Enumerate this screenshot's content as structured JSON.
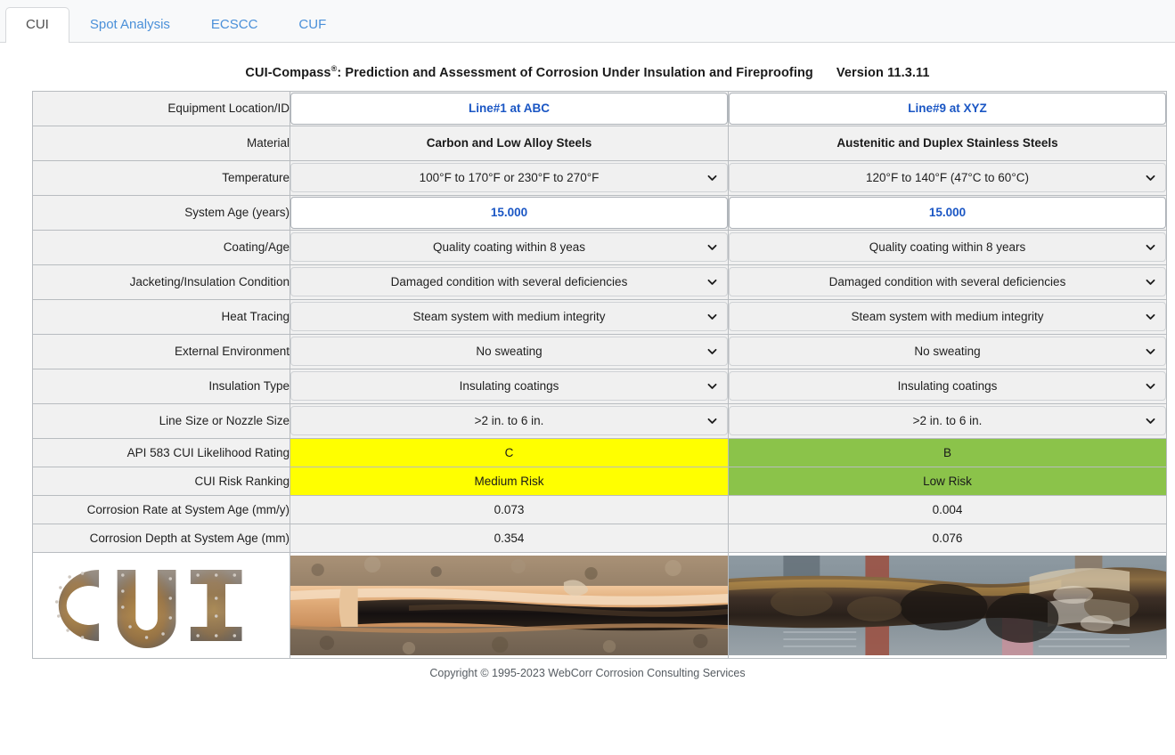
{
  "tabs": [
    {
      "label": "CUI",
      "active": true
    },
    {
      "label": "Spot Analysis",
      "active": false
    },
    {
      "label": "ECSCC",
      "active": false
    },
    {
      "label": "CUF",
      "active": false
    }
  ],
  "header": {
    "title_main": "CUI-Compass",
    "registered_mark": "®",
    "title_rest": ": Prediction and Assessment of Corrosion Under Insulation and Fireproofing",
    "version": "Version 11.3.11"
  },
  "table": {
    "rows": [
      {
        "label": "Equipment Location/ID",
        "kind": "input",
        "col1": "Line#1 at ABC",
        "col2": "Line#9 at XYZ"
      },
      {
        "label": "Material",
        "kind": "text",
        "col1": "Carbon and Low Alloy Steels",
        "col2": "Austenitic and Duplex Stainless Steels"
      },
      {
        "label": "Temperature",
        "kind": "select",
        "col1": "100°F to 170°F or 230°F to 270°F",
        "col2": "120°F to 140°F (47°C to 60°C)"
      },
      {
        "label": "System Age (years)",
        "kind": "input",
        "col1": "15.000",
        "col2": "15.000"
      },
      {
        "label": "Coating/Age",
        "kind": "select",
        "col1": "Quality coating within 8 yeas",
        "col2": "Quality coating within 8 years"
      },
      {
        "label": "Jacketing/Insulation Condition",
        "kind": "select",
        "col1": "Damaged condition with several deficiencies",
        "col2": "Damaged condition with several deficiencies"
      },
      {
        "label": "Heat Tracing",
        "kind": "select",
        "col1": "Steam system with medium integrity",
        "col2": "Steam system with medium integrity"
      },
      {
        "label": "External Environment",
        "kind": "select",
        "col1": "No sweating",
        "col2": "No sweating"
      },
      {
        "label": "Insulation Type",
        "kind": "select",
        "col1": "Insulating coatings",
        "col2": "Insulating coatings"
      },
      {
        "label": "Line Size or Nozzle Size",
        "kind": "select",
        "col1": ">2 in. to 6 in.",
        "col2": ">2 in. to 6 in."
      }
    ],
    "results": [
      {
        "label": "API 583 CUI Likelihood Rating",
        "col1": "C",
        "col2": "B",
        "col1_style": "yellow",
        "col2_style": "green"
      },
      {
        "label": "CUI Risk Ranking",
        "col1": "Medium Risk",
        "col2": "Low Risk",
        "col1_style": "yellow",
        "col2_style": "green"
      },
      {
        "label": "Corrosion Rate at System Age (mm/y)",
        "col1": "0.073",
        "col2": "0.004",
        "col1_style": "grey",
        "col2_style": "grey"
      },
      {
        "label": "Corrosion Depth at System Age (mm)",
        "col1": "0.354",
        "col2": "0.076",
        "col1_style": "grey",
        "col2_style": "grey"
      }
    ],
    "images": [
      {
        "alt": "CUI rusted metal letters logo"
      },
      {
        "alt": "Corroded pipe under stripped insulation"
      },
      {
        "alt": "Heavily corroded insulated pipe section"
      }
    ]
  },
  "colors": {
    "yellow": "#ffff00",
    "green": "#8bc34a",
    "link_blue": "#4a90d9",
    "value_blue": "#1a56c4"
  },
  "footer": {
    "copyright": "Copyright © 1995-2023 WebCorr Corrosion Consulting Services"
  }
}
